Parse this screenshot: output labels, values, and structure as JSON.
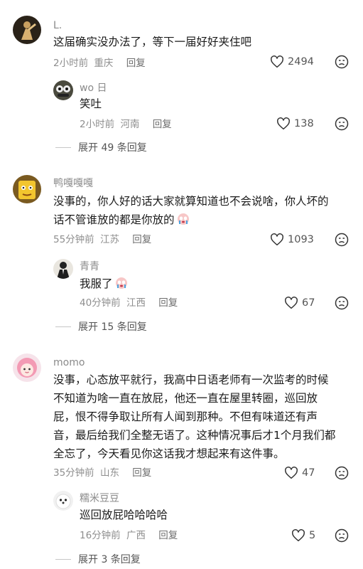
{
  "comments": [
    {
      "user": "L.",
      "text": "这届确实没办法了，等下一届好好夹住吧",
      "time": "2小时前",
      "location": "重庆",
      "reply_label": "回复",
      "likes": "2494",
      "replies": [
        {
          "user": "wo 日",
          "text": "笑吐",
          "time": "2小时前",
          "location": "河南",
          "reply_label": "回复",
          "likes": "138"
        }
      ],
      "expand_label": "展开 49 条回复"
    },
    {
      "user": "鸭嘎嘎嘎",
      "text_line1": "没事的，你人好的话大家就算知道也不会说啥，你人坏的",
      "text_line2": "话不管谁放的都是你放的",
      "time": "55分钟前",
      "location": "江苏",
      "reply_label": "回复",
      "likes": "1093",
      "replies": [
        {
          "user": "青青",
          "text": "我服了",
          "time": "40分钟前",
          "location": "江西",
          "reply_label": "回复",
          "likes": "67"
        }
      ],
      "expand_label": "展开 15 条回复"
    },
    {
      "user": "momo",
      "lines": [
        "没事，心态放平就行，我高中日语老师有一次监考的时候",
        "不知道为啥一直在放屁，他还一直在屋里转圈，巡回放",
        "屁，恨不得争取让所有人闻到那种。不但有味道还有声",
        "音，最后给我们全整无语了。这种情况事后才1个月我们都",
        "全忘了，今天看见你这话我才想起来有这件事。"
      ],
      "time": "35分钟前",
      "location": "山东",
      "reply_label": "回复",
      "likes": "47",
      "replies": [
        {
          "user": "糯米豆豆",
          "text": "巡回放屁哈哈哈哈",
          "time": "16分钟前",
          "location": "广西",
          "reply_label": "回复",
          "likes": "5"
        }
      ],
      "expand_label": "展开 3 条回复"
    }
  ],
  "icons": {
    "like": "heart-outline-icon",
    "dislike": "frown-face-icon",
    "emoji": "crying-face-emoji"
  },
  "colors": {
    "name": "#8a8a8a",
    "text": "#1b1b1b",
    "meta": "#8e8e8e"
  }
}
